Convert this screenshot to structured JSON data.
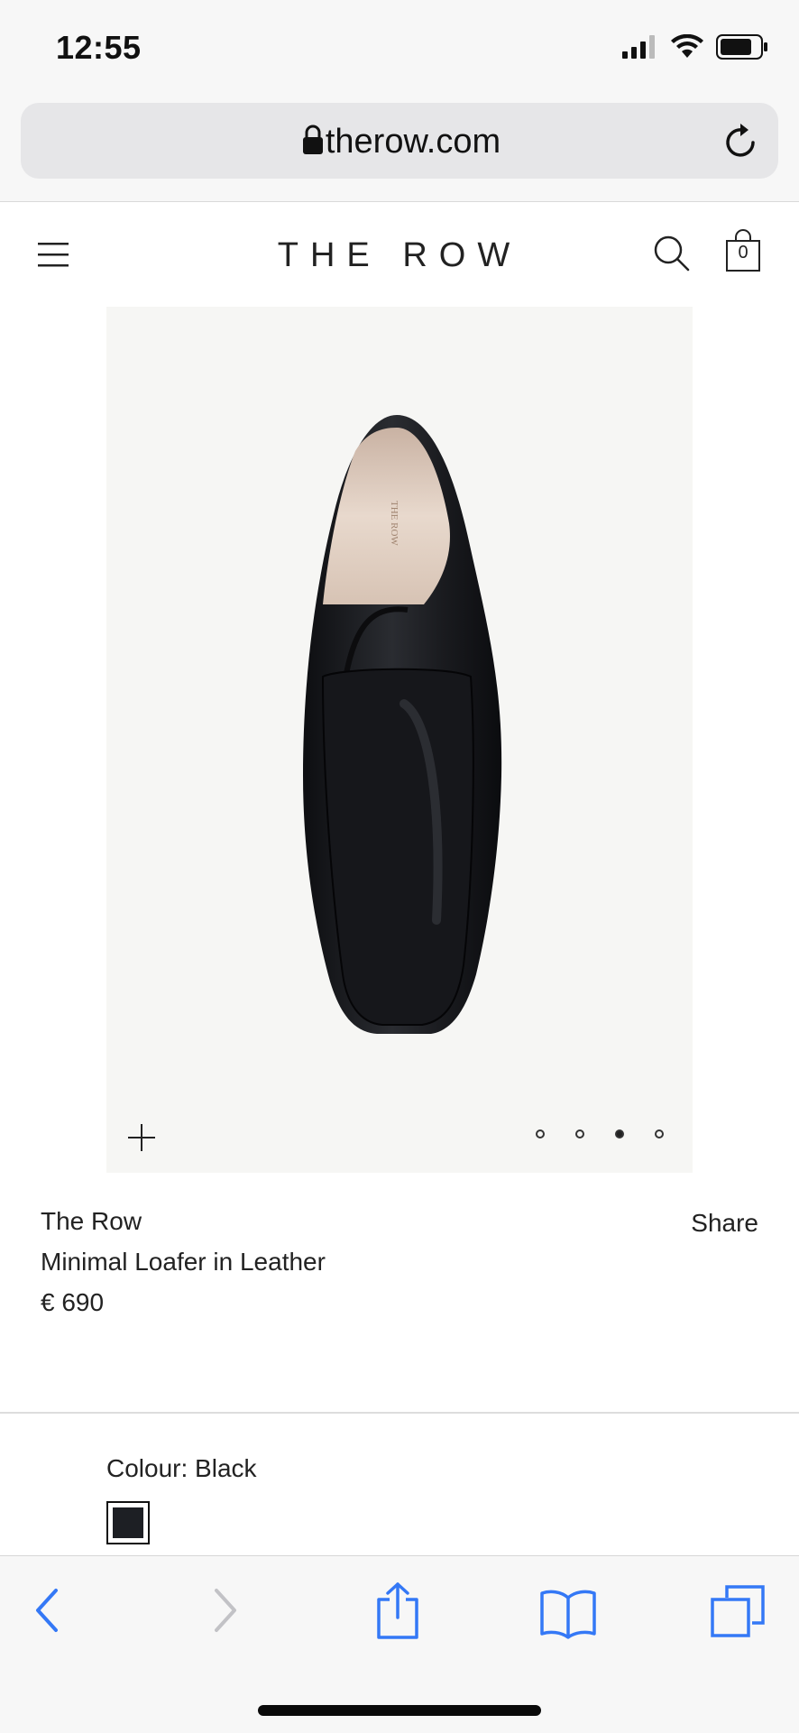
{
  "status_bar": {
    "time": "12:55"
  },
  "browser": {
    "url": "therow.com"
  },
  "site": {
    "brand_logo": "THE ROW",
    "bag_count": "0"
  },
  "product": {
    "image_label": "THE ROW",
    "carousel_active_index": 3,
    "carousel_total": 4,
    "brand": "The Row",
    "name": "Minimal Loafer in Leather",
    "price": "€ 690",
    "share_label": "Share",
    "colour_label": "Colour: Black",
    "swatch_color": "#1d1f24"
  },
  "colors": {
    "accent": "#3478f6",
    "toolbar_bg": "#f7f7f7"
  }
}
